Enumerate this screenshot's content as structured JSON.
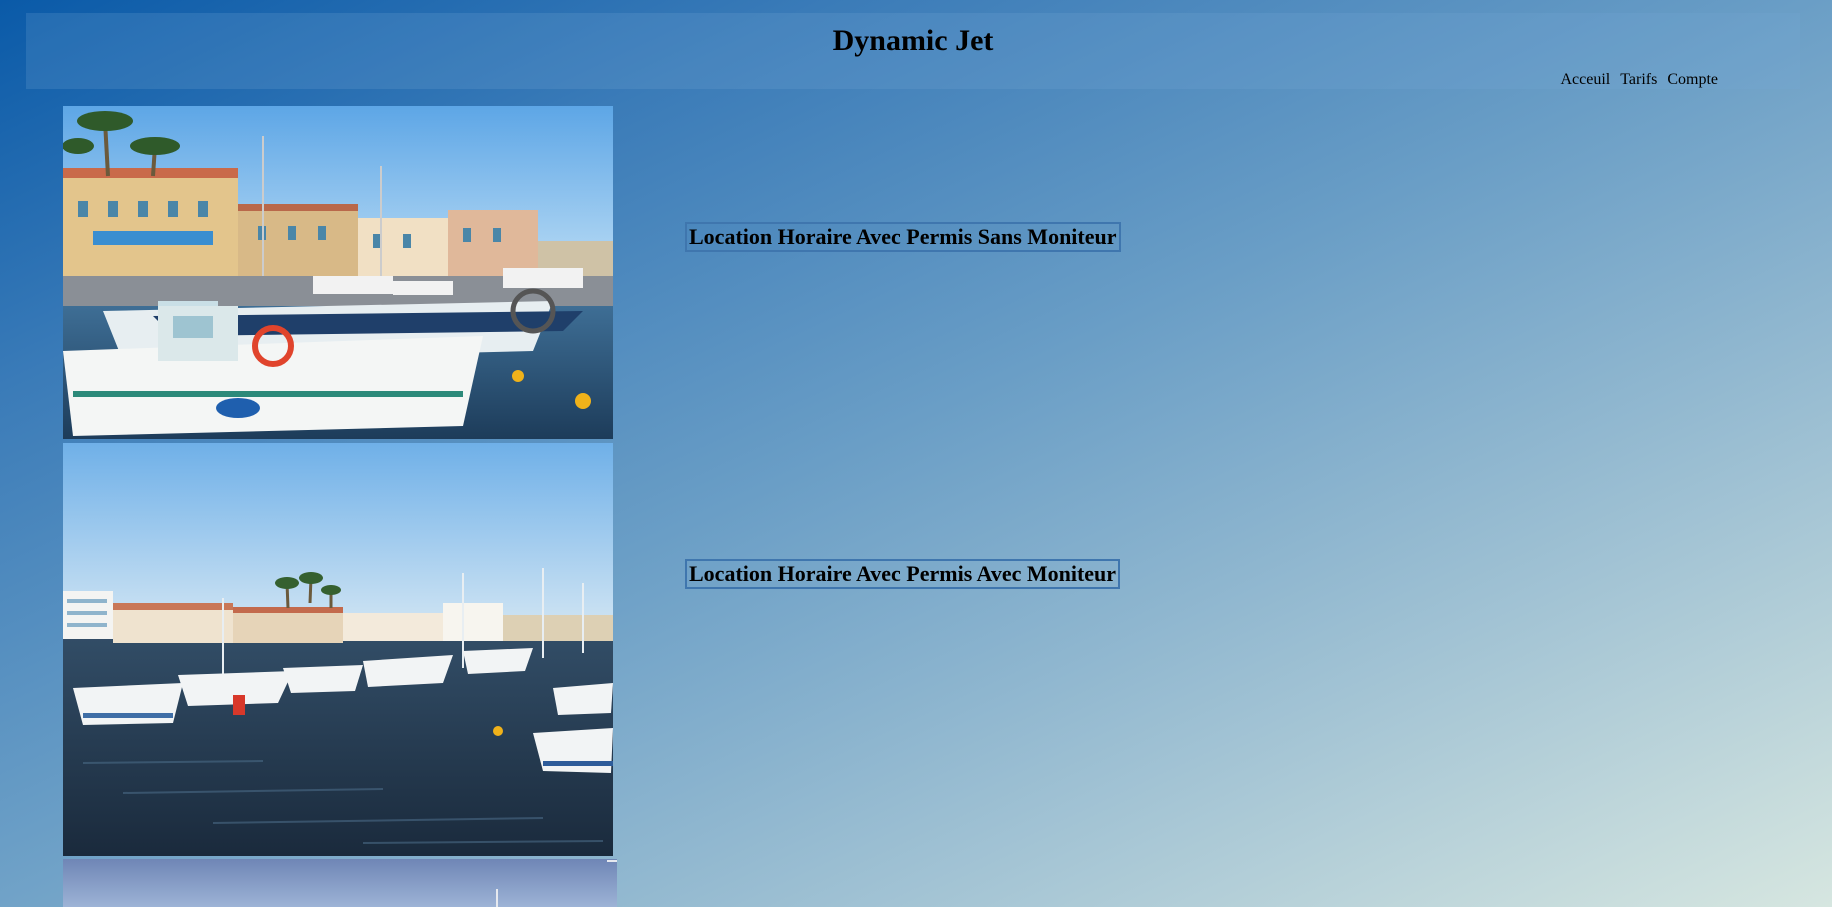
{
  "header": {
    "title": "Dynamic Jet",
    "nav": {
      "home": "Acceuil",
      "pricing": "Tarifs",
      "account": "Compte"
    }
  },
  "offers": [
    {
      "label": "Location Horaire Avec Permis Sans Moniteur"
    },
    {
      "label": "Location Horaire Avec Permis Avec Moniteur"
    }
  ],
  "colors": {
    "background_start": "#0a5aa8",
    "background_end": "#d6e6e0",
    "link_border": "#3f76ae"
  }
}
